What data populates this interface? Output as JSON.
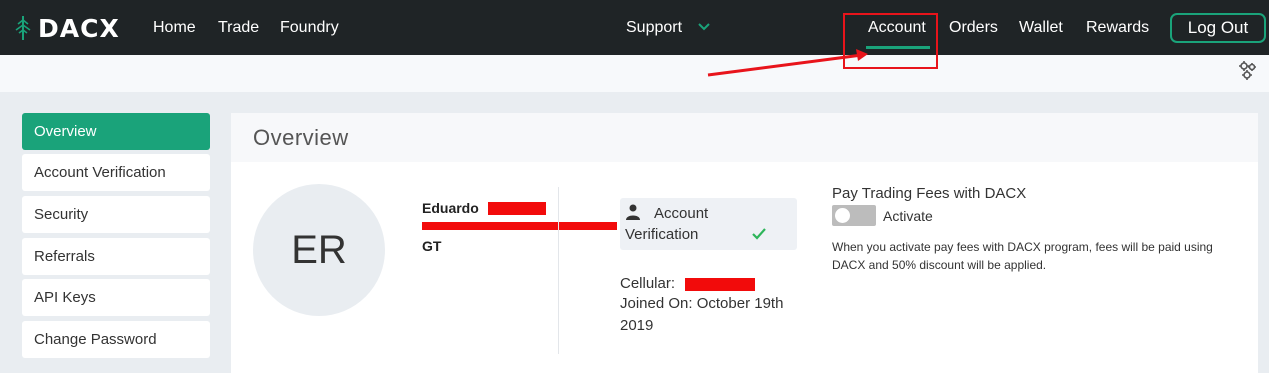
{
  "brand": {
    "name": "DACX",
    "accent": "#1aa37a"
  },
  "nav": {
    "left": [
      {
        "label": "Home"
      },
      {
        "label": "Trade"
      },
      {
        "label": "Foundry"
      }
    ],
    "support": {
      "label": "Support",
      "icon": "chevron-down-icon"
    },
    "right": [
      {
        "label": "Account",
        "active": true
      },
      {
        "label": "Orders"
      },
      {
        "label": "Wallet"
      },
      {
        "label": "Rewards"
      }
    ],
    "logout_label": "Log Out"
  },
  "sidebar": {
    "items": [
      {
        "label": "Overview",
        "active": true
      },
      {
        "label": "Account Verification"
      },
      {
        "label": "Security"
      },
      {
        "label": "Referrals"
      },
      {
        "label": "API Keys"
      },
      {
        "label": "Change Password"
      }
    ]
  },
  "overview": {
    "title": "Overview",
    "avatar_initials": "ER",
    "user": {
      "first_name": "Eduardo",
      "country": "GT"
    },
    "verification": {
      "line1": "Account",
      "line2": "Verification",
      "verified": true
    },
    "cellular_label": "Cellular:",
    "joined_line1": "Joined On: October 19th",
    "joined_line2": "2019",
    "fees": {
      "title": "Pay Trading Fees with DACX",
      "toggle_label": "Activate",
      "toggle_on": false,
      "description": "When you activate pay fees with DACX program, fees will be paid using DACX and 50% discount will be applied."
    }
  },
  "annotation_color": "#e8141b"
}
